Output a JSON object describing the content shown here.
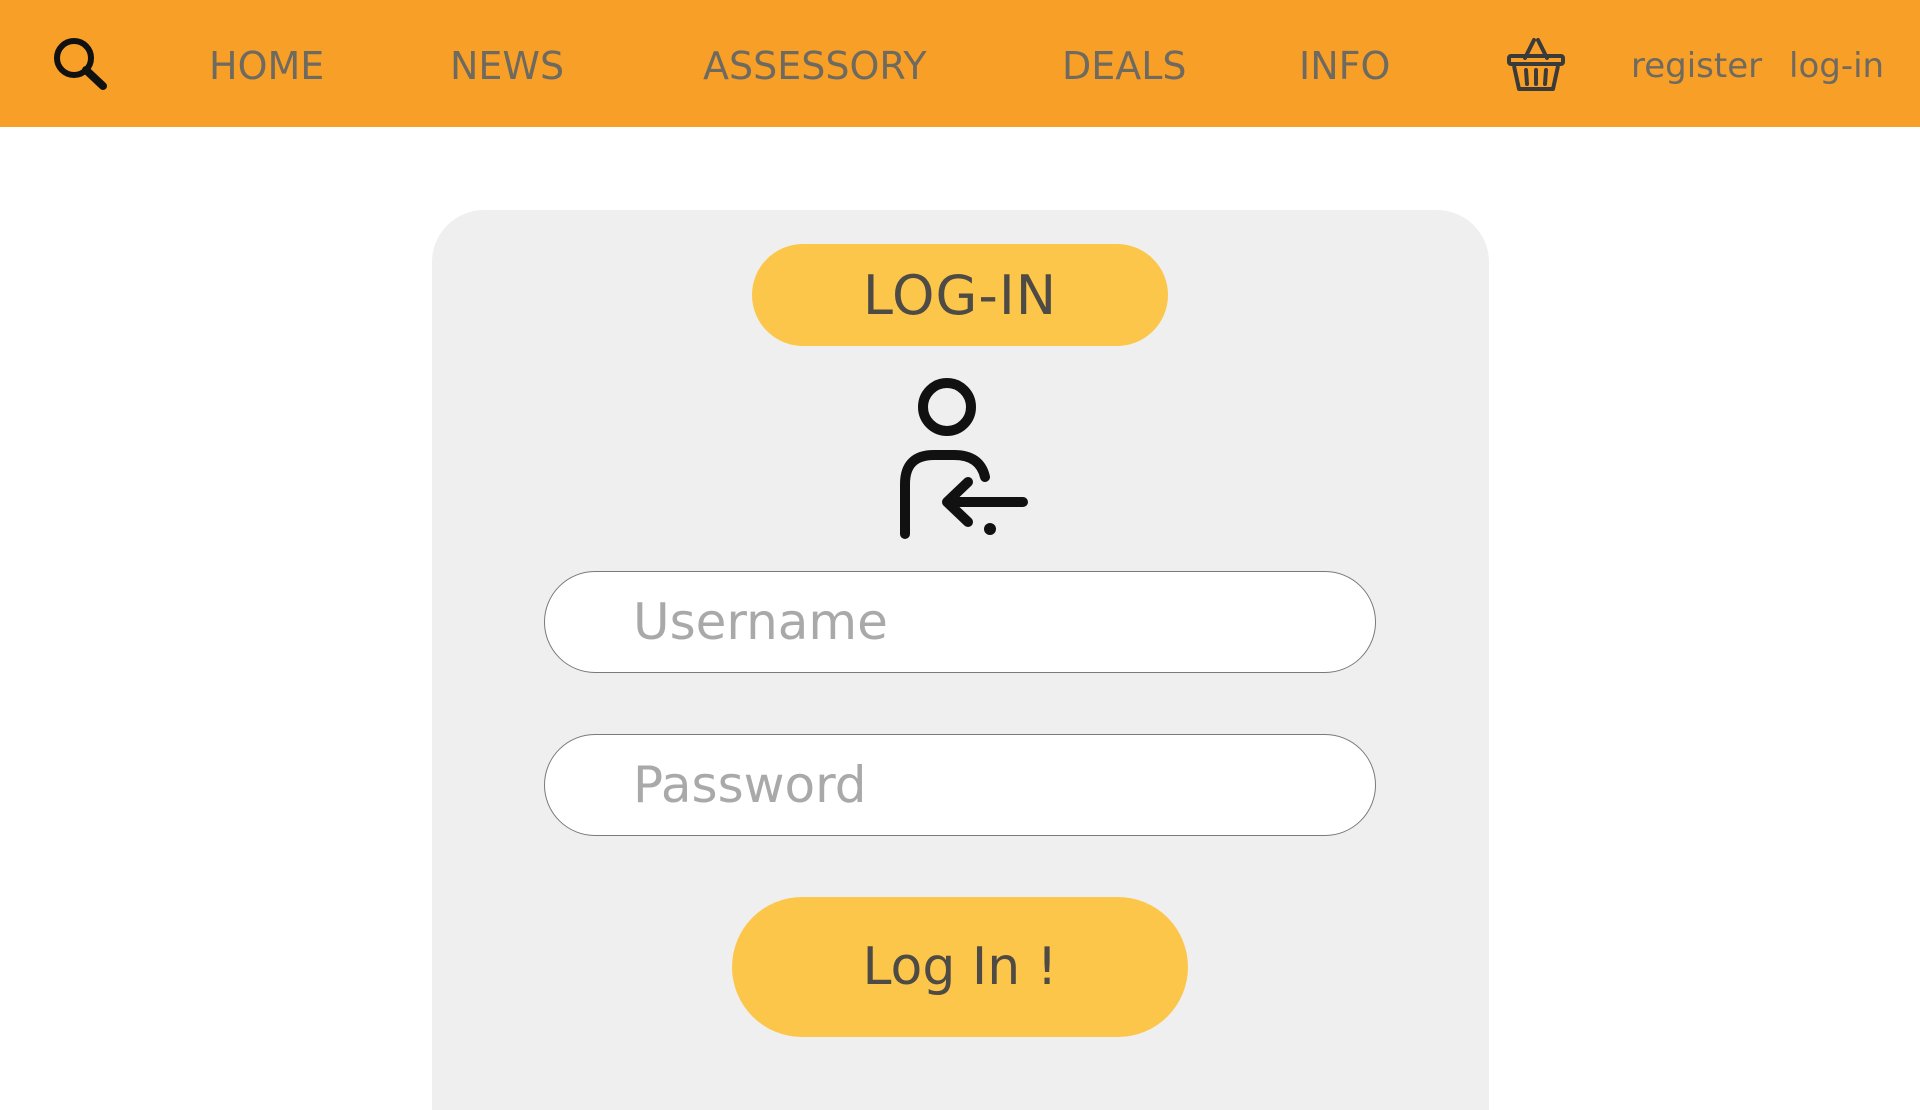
{
  "nav": {
    "search_icon": "search-icon",
    "items": [
      {
        "label": "HOME"
      },
      {
        "label": "NEWS"
      },
      {
        "label": "ASSESSORY"
      },
      {
        "label": "DEALS"
      },
      {
        "label": "INFO"
      }
    ],
    "basket_icon": "shopping-basket-icon",
    "register_label": "register",
    "login_label": "log-in"
  },
  "login_panel": {
    "title": "LOG-IN",
    "icon": "user-login-icon",
    "username_placeholder": "Username",
    "password_placeholder": "Password",
    "submit_label": "Log In !"
  },
  "colors": {
    "header_bg": "#F89F27",
    "accent": "#FCC64A",
    "panel_bg": "#EFEFEF",
    "nav_text": "#6E6A60"
  }
}
